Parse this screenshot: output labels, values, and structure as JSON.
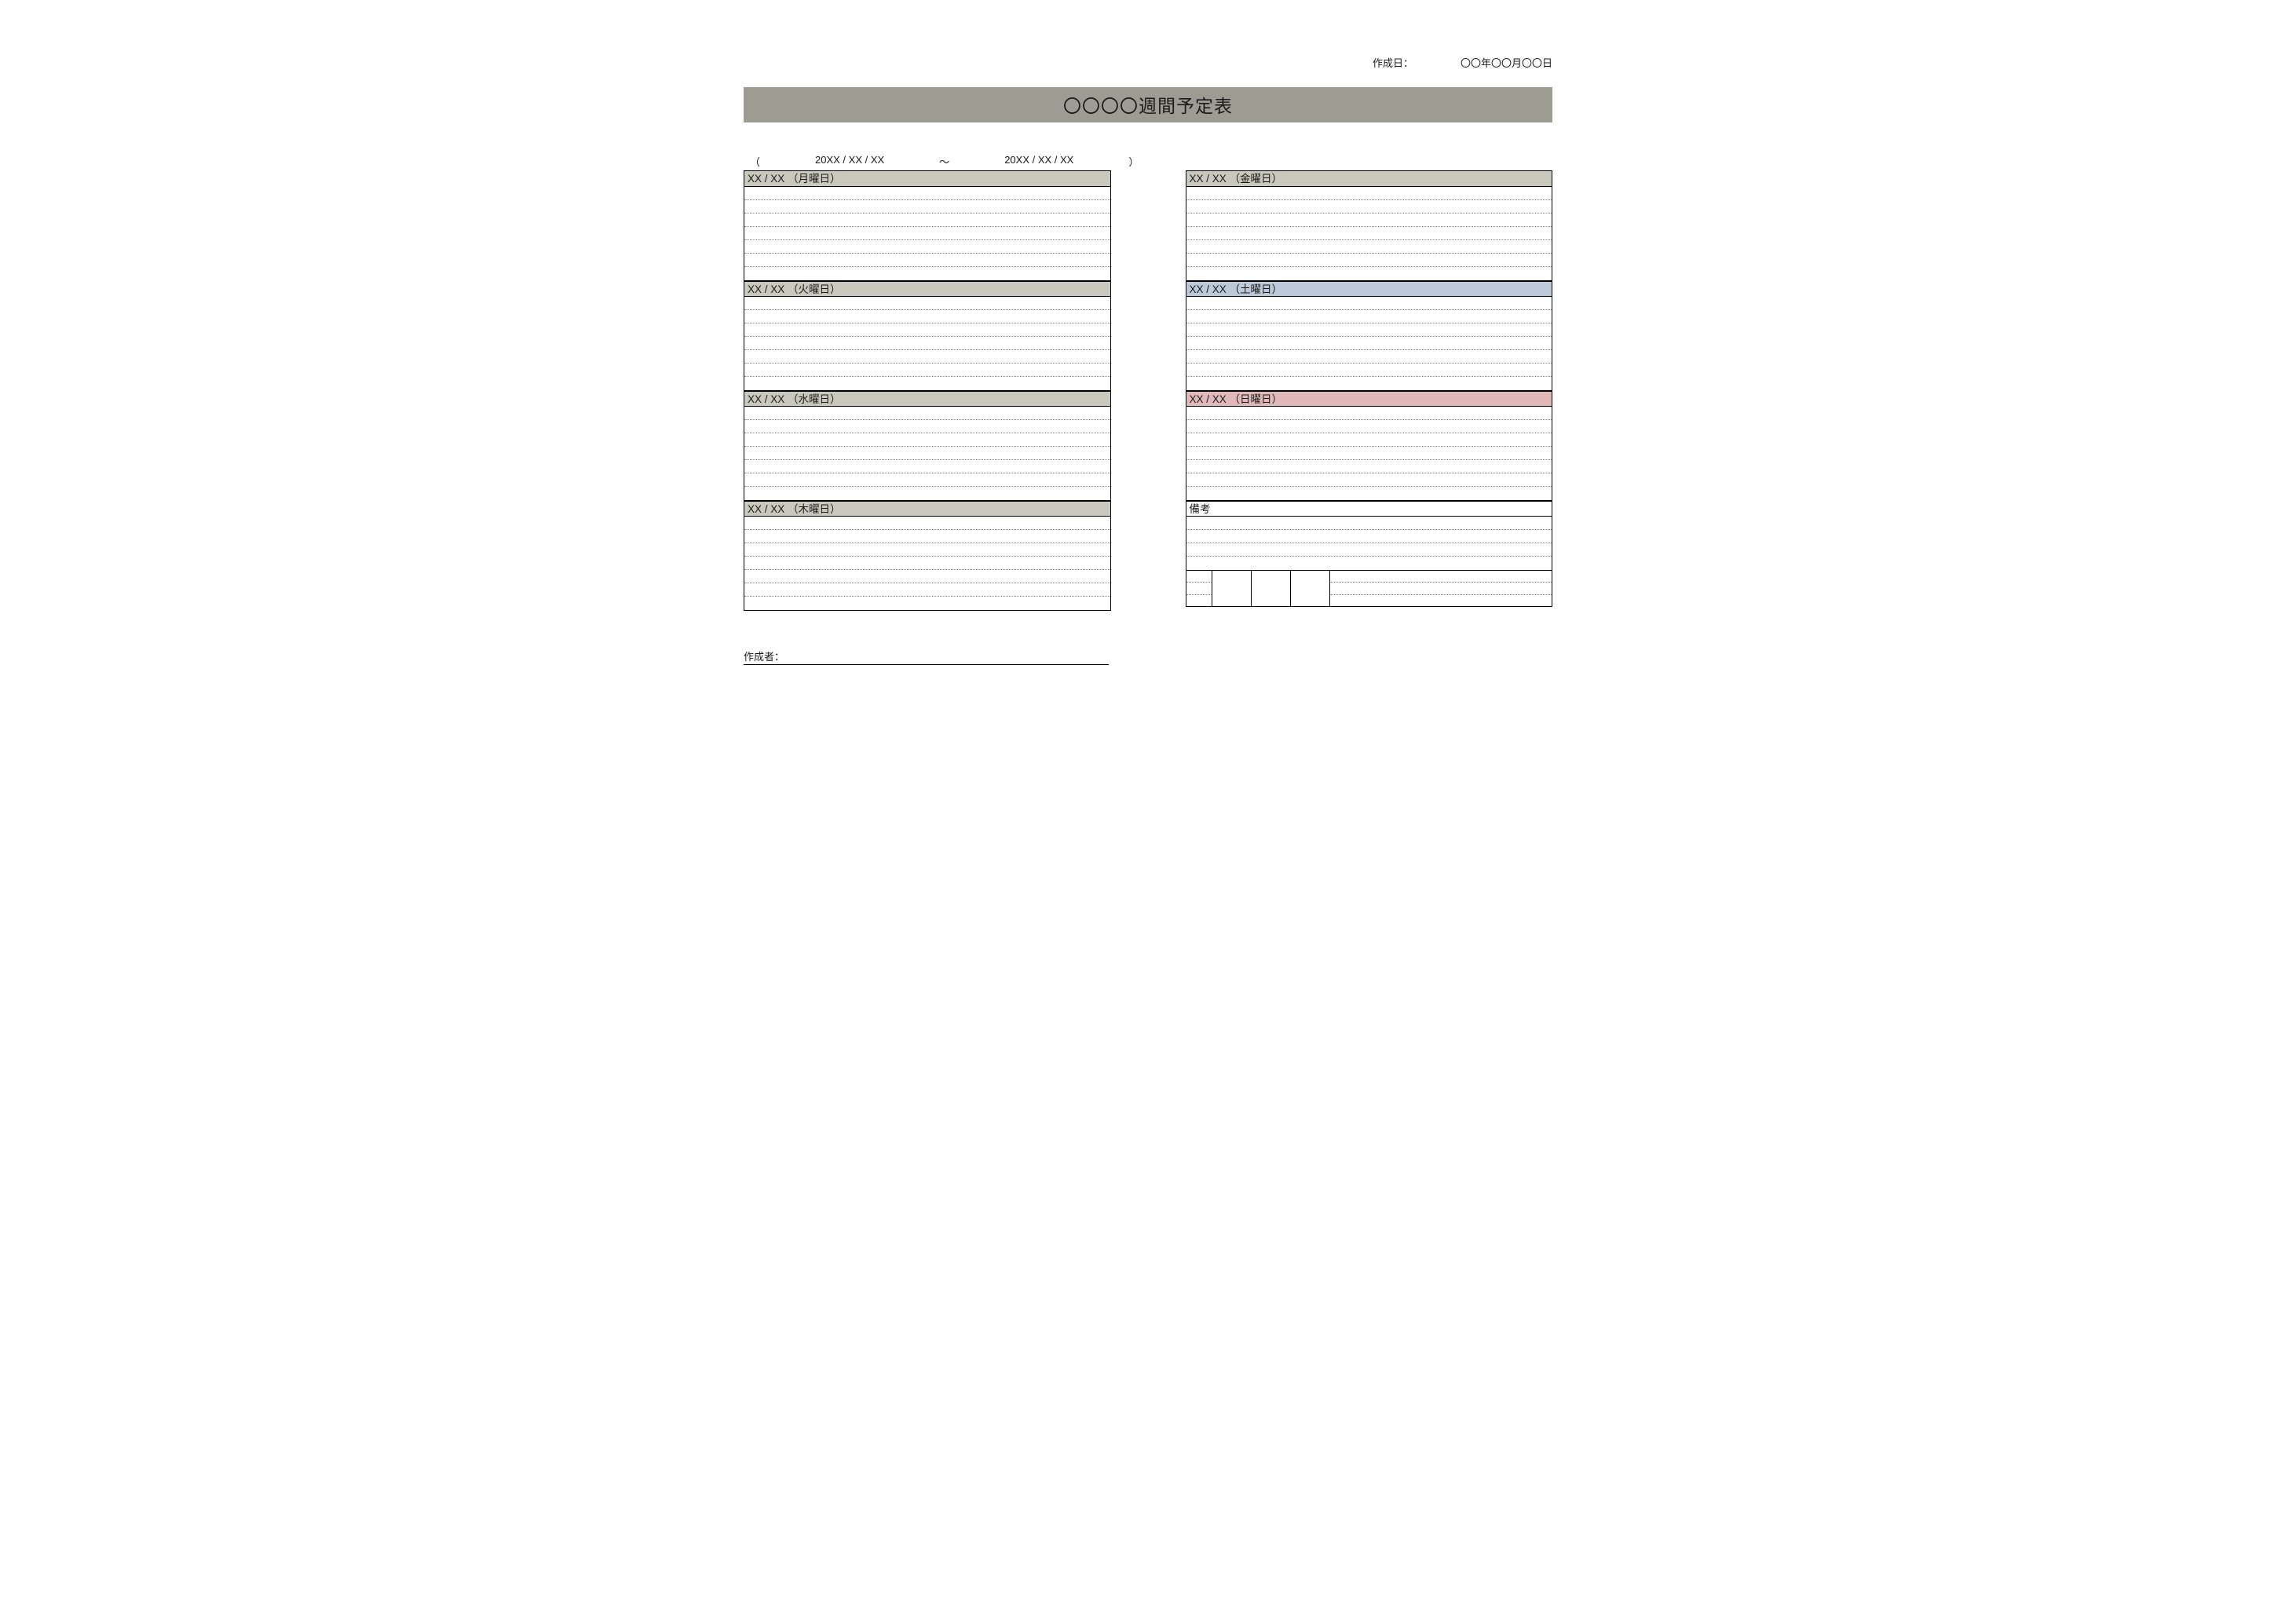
{
  "meta": {
    "created_label": "作成日：",
    "created_value": "〇〇年〇〇月〇〇日"
  },
  "title": "〇〇〇〇週間予定表",
  "range": {
    "open": "（",
    "start": "20XX / XX / XX",
    "tilde": "～",
    "end": "20XX / XX / XX",
    "close": "）"
  },
  "days": {
    "mon": "XX / XX （月曜日）",
    "tue": "XX / XX （火曜日）",
    "wed": "XX / XX （水曜日）",
    "thu": "XX / XX （木曜日）",
    "fri": "XX / XX （金曜日）",
    "sat": "XX / XX （土曜日）",
    "sun": "XX / XX （日曜日）"
  },
  "remarks_label": "備考",
  "author_label": "作成者："
}
